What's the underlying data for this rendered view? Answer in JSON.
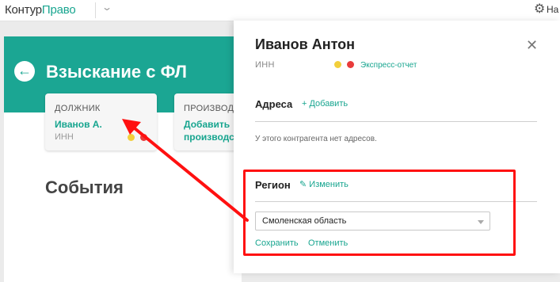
{
  "app": {
    "logo_main": "Контур",
    "logo_accent": "Право",
    "settings_label": "На"
  },
  "case": {
    "title": "Взыскание с ФЛ",
    "debtor": {
      "label": "ДОЛЖНИК",
      "name": "Иванов А.",
      "inn_label": "ИНН"
    },
    "proceeding": {
      "label": "ПРОИЗВОДСТВО",
      "link_line1": "Добавить",
      "link_line2": "производство"
    },
    "events_title": "События"
  },
  "panel": {
    "name": "Иванов Антон",
    "inn_label": "ИНН",
    "express_report": "Экспресс-отчет",
    "addresses": {
      "title": "Адреса",
      "add_label": "+ Добавить",
      "empty_text": "У этого контрагента нет адресов."
    },
    "region": {
      "title": "Регион",
      "edit_label": "Изменить",
      "selected_value": "Смоленская область",
      "save_label": "Сохранить",
      "cancel_label": "Отменить"
    }
  },
  "colors": {
    "accent": "#17a58f",
    "hero": "#1ba693",
    "status_yellow": "#f2cf3b",
    "status_red": "#e93b3b",
    "annotation": "#ff1010"
  },
  "icons": {
    "gear": "gear-icon",
    "chevron": "chevron-down-icon",
    "back": "arrow-left-icon",
    "close": "close-icon",
    "pencil": "pencil-icon"
  }
}
